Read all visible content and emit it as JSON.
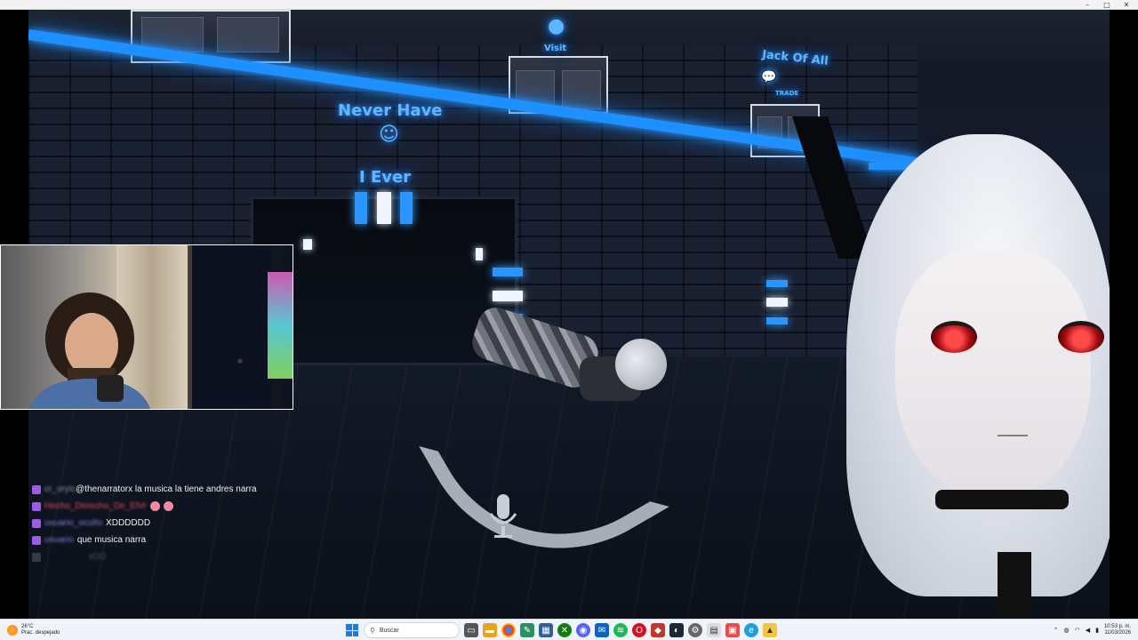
{
  "window": {
    "controls": {
      "minimize": "–",
      "maximize": "□",
      "close": "✕"
    }
  },
  "scene": {
    "signs": {
      "never_have": "Never Have",
      "i_ever": "I Ever",
      "jack_of_all": "Jack Of All",
      "trade": "TRADE",
      "visit": "Visit"
    }
  },
  "chat": {
    "messages": [
      {
        "user": "cr_oryic",
        "text": "@thenarratorx la musica la tiene andres narra",
        "blurred_user": false
      },
      {
        "user": "Hecho_Derecho_De_ElVr",
        "text": "",
        "blurred_user": true,
        "emotes": 2,
        "user_color": "#e0475a"
      },
      {
        "user": "usuario_oculto",
        "text": "XDDDDDD",
        "blurred_user": true,
        "user_color": "#7b7fd8"
      },
      {
        "user": "usuario",
        "text": "que musica narra",
        "blurred_user": true,
        "user_color": "#7b7fd8"
      },
      {
        "user": "",
        "text": "xDD",
        "blurred_user": true
      }
    ]
  },
  "taskbar": {
    "weather": {
      "temp": "26°C",
      "condition": "Prac. despejado"
    },
    "search_placeholder": "Buscar",
    "clock": {
      "time": "10:53 p. m.",
      "date": "11/03/2026"
    },
    "apps": [
      "task-view",
      "file-explorer",
      "chrome",
      "notes",
      "store",
      "xbox",
      "discord",
      "mail",
      "spotify",
      "opera",
      "app-red",
      "steam",
      "settings",
      "app-white",
      "photos",
      "edge",
      "app-yellow"
    ]
  },
  "colors": {
    "neon_blue": "#1e90ff",
    "eye_red": "#ff4a4a",
    "taskbar_bg": "#f0f3f9"
  }
}
